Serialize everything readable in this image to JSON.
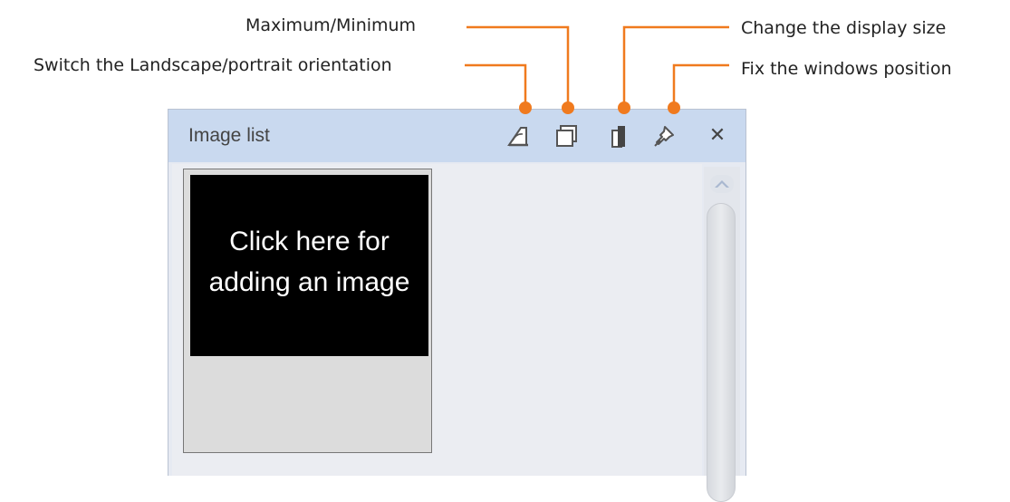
{
  "callouts": {
    "maximum_minimum": "Maximum/Minimum",
    "switch_orientation": "Switch the Landscape/portrait orientation",
    "change_display_size": "Change the display size",
    "fix_window_position": "Fix the windows position"
  },
  "panel": {
    "title": "Image list",
    "close_glyph": "✕",
    "add_image_text": "Click here for adding an image"
  },
  "icons": {
    "orientation": "orientation-icon",
    "maxmin": "maximize-minimize-icon",
    "size": "display-size-icon",
    "pin": "pin-icon",
    "close": "close-icon",
    "scroll_up": "scroll-up-arrow-icon"
  },
  "colors": {
    "accent_orange": "#f07a1e",
    "titlebar": "#c9d9ef",
    "content_bg": "#ebedf2"
  }
}
